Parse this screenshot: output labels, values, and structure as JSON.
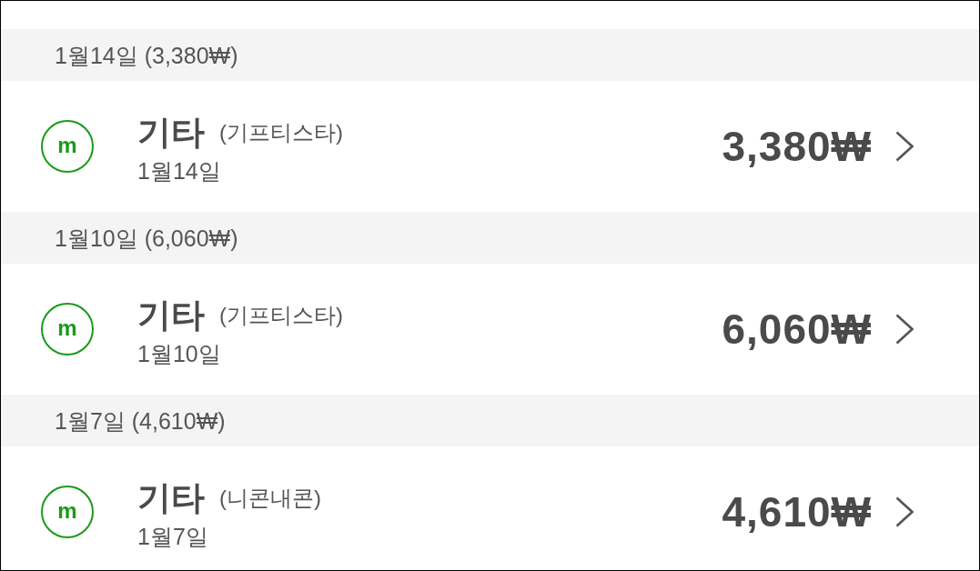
{
  "groups": [
    {
      "header": "1월14일 (3,380₩)",
      "transactions": [
        {
          "logo_letter": "m",
          "category": "기타",
          "merchant": "(기프티스타)",
          "date": "1월14일",
          "amount": "3,380₩"
        }
      ]
    },
    {
      "header": "1월10일 (6,060₩)",
      "transactions": [
        {
          "logo_letter": "m",
          "category": "기타",
          "merchant": "(기프티스타)",
          "date": "1월10일",
          "amount": "6,060₩"
        }
      ]
    },
    {
      "header": "1월7일 (4,610₩)",
      "transactions": [
        {
          "logo_letter": "m",
          "category": "기타",
          "merchant": "(니콘내콘)",
          "date": "1월7일",
          "amount": "4,610₩"
        }
      ]
    }
  ]
}
